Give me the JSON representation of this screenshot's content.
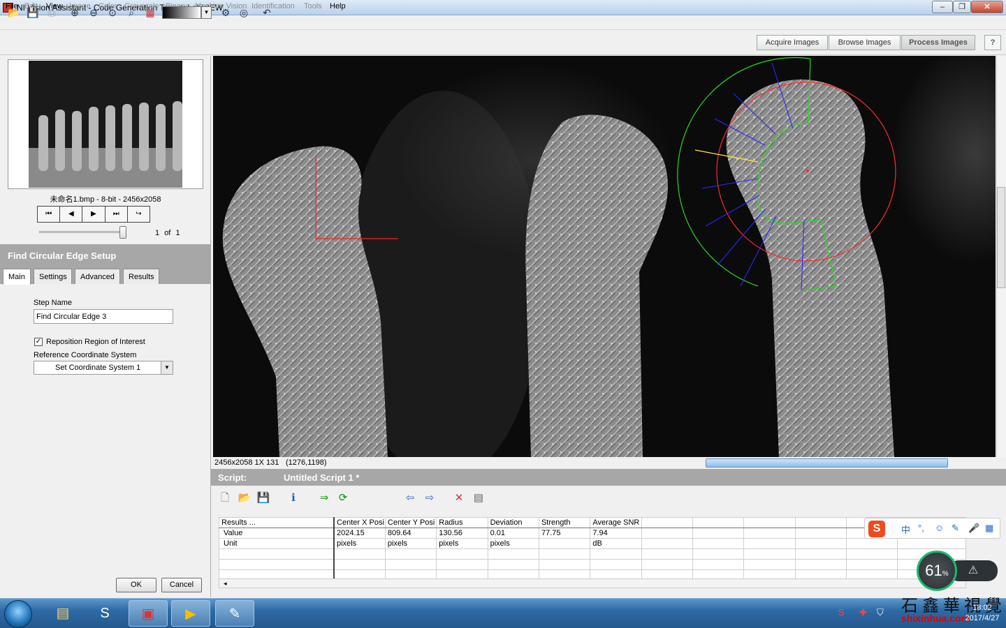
{
  "window": {
    "title": "NI Vision Assistant - Code Generation Target: LabVIEW",
    "minimize": "–",
    "maximize": "❐",
    "close": "✕"
  },
  "menu": [
    "File",
    "Edit",
    "View",
    "Image",
    "Color",
    "Grayscale",
    "Binary",
    "Machine Vision",
    "Identification",
    "Tools",
    "Help"
  ],
  "modes": {
    "acquire": "Acquire Images",
    "browse": "Browse Images",
    "process": "Process Images",
    "help": "?"
  },
  "thumbnail": {
    "caption": "未命名1.bmp - 8-bit - 2456x2058"
  },
  "navigation": {
    "page": "1",
    "of": "of",
    "total": "1"
  },
  "setup": {
    "title": "Find Circular Edge Setup",
    "tabs": [
      "Main",
      "Settings",
      "Advanced",
      "Results"
    ],
    "step_name_label": "Step Name",
    "step_name_value": "Find Circular Edge 3",
    "reposition_label": "Reposition Region of Interest",
    "reposition_checked": true,
    "ref_label": "Reference Coordinate System",
    "ref_value": "Set Coordinate System 1",
    "ok": "OK",
    "cancel": "Cancel"
  },
  "status": {
    "info": "2456x2058 1X 131",
    "coord": "(1276,1198)"
  },
  "script": {
    "label": "Script:",
    "name": "Untitled Script 1 *"
  },
  "results": {
    "headers": [
      "Results ...",
      "Center X Posi",
      "Center Y Posi",
      "Radius",
      "Deviation",
      "Strength",
      "Average SNR",
      "",
      "",
      "",
      "",
      "",
      ""
    ],
    "rows": [
      [
        "Value",
        "2024.15",
        "809.64",
        "130.56",
        "0.01",
        "77.75",
        "7.94"
      ],
      [
        "Unit",
        "pixels",
        "pixels",
        "pixels",
        "pixels",
        "",
        "dB"
      ]
    ]
  },
  "ime": {
    "mode": "中",
    "punct": "°,",
    "emoji": "☺",
    "tools": "✎",
    "mic": "🎤",
    "grid": "▦"
  },
  "network": {
    "percent": "61",
    "unit": "%"
  },
  "taskbar": {
    "clock_time": "18:02",
    "clock_date": "2017/4/27"
  },
  "watermark": {
    "text": "石鑫華視覺",
    "url": "shixinhua.com"
  }
}
